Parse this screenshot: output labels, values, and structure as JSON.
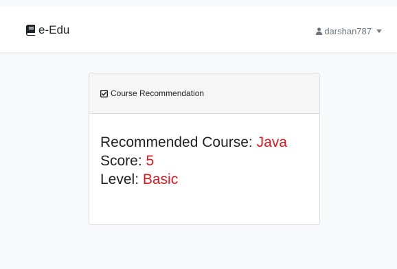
{
  "navbar": {
    "brand_label": "e-Edu",
    "brand_icon": "book-icon",
    "user_name": "darshan787",
    "user_icon": "user-icon",
    "caret_icon": "caret-down-icon"
  },
  "card": {
    "header_icon": "check-square-icon",
    "header_title": "Course Recommendation",
    "course_label": "Recommended Course: ",
    "course_value": "Java",
    "score_label": "Score: ",
    "score_value": "5",
    "level_label": "Level: ",
    "level_value": "Basic"
  },
  "colors": {
    "accent_value": "#e3151e",
    "background": "#f8f9fa",
    "card_header_bg": "#f6f6f6"
  }
}
